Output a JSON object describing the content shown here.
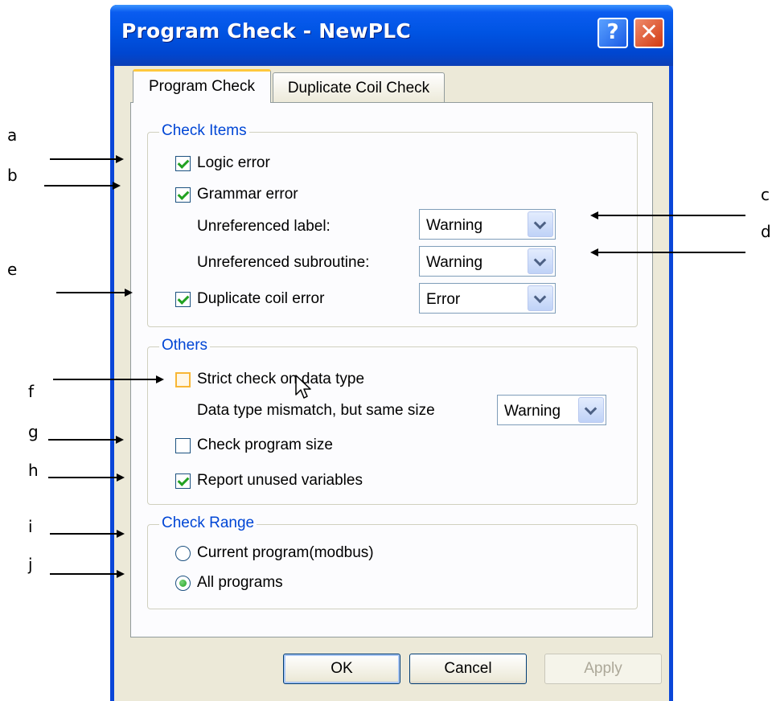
{
  "window": {
    "title": "Program Check - NewPLC",
    "help_glyph": "?",
    "close_glyph": "✕"
  },
  "tabs": [
    {
      "label": "Program Check",
      "active": true
    },
    {
      "label": "Duplicate Coil Check",
      "active": false
    }
  ],
  "check_items": {
    "title": "Check Items",
    "logic_error": {
      "label": "Logic error",
      "checked": true
    },
    "grammar_error": {
      "label": "Grammar error",
      "checked": true
    },
    "unreferenced_label": {
      "label": "Unreferenced label:",
      "value": "Warning"
    },
    "unreferenced_subroutine": {
      "label": "Unreferenced subroutine:",
      "value": "Warning"
    },
    "duplicate_coil_error": {
      "label": "Duplicate coil error",
      "checked": true,
      "value": "Error"
    }
  },
  "others": {
    "title": "Others",
    "strict_check": {
      "label": "Strict check on data type",
      "checked": false
    },
    "data_type_mismatch": {
      "label": "Data type mismatch, but same size",
      "value": "Warning"
    },
    "check_program_size": {
      "label": "Check program size",
      "checked": false
    },
    "report_unused": {
      "label": "Report unused variables",
      "checked": true
    }
  },
  "check_range": {
    "title": "Check Range",
    "options": [
      {
        "label": "Current program(modbus)",
        "selected": false
      },
      {
        "label": "All programs",
        "selected": true
      }
    ]
  },
  "buttons": {
    "ok": "OK",
    "cancel": "Cancel",
    "apply": "Apply",
    "apply_enabled": false
  },
  "annotations": [
    "a",
    "b",
    "c",
    "d",
    "e",
    "f",
    "g",
    "h",
    "i",
    "j"
  ],
  "colors": {
    "titlebar": "#0054e3",
    "group_title": "#0046d5",
    "check_green": "#21a121",
    "tab_highlight": "#ffc83c"
  }
}
